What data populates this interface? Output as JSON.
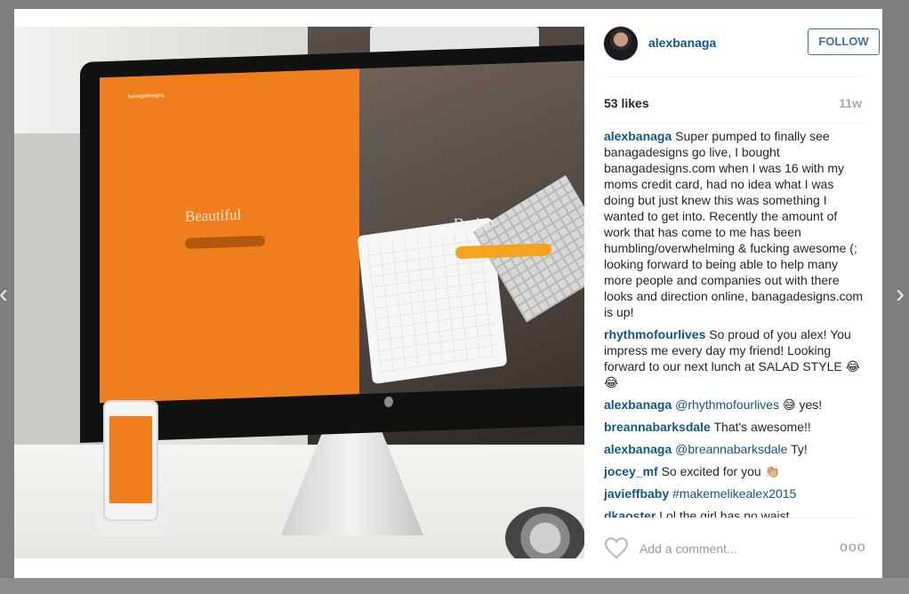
{
  "post": {
    "author": "alexbanaga",
    "follow_label": "FOLLOW",
    "likes": "53 likes",
    "time_ago": "11w"
  },
  "photo": {
    "screen_tag": "banagadesigns",
    "orange_word": "Beautiful",
    "right_word": "Design"
  },
  "comments": [
    {
      "user": "alexbanaga",
      "text": "Super pumped to finally see banagadesigns go live, I bought banagadesigns.com when I was 16 with my moms credit card, had no idea what I was doing but just knew this was something I wanted to get into. Recently the amount of work that has come to me has been humbling/overwhelming & fucking awesome (; looking forward to being able to help many more people and companies out with there looks and direction online, banagadesigns.com is up!"
    },
    {
      "user": "rhythmofourlives",
      "text": "So proud of you alex! You impress me every day my friend! Looking forward to our next lunch at SALAD STYLE 😂😂"
    },
    {
      "user": "alexbanaga",
      "mention": "@rhythmofourlives",
      "text": "😅 yes!"
    },
    {
      "user": "breannabarksdale",
      "text": "That's awesome!!"
    },
    {
      "user": "alexbanaga",
      "mention": "@breannabarksdale",
      "text": "Ty!"
    },
    {
      "user": "jocey_mf",
      "text": "So excited for you 👏🏼"
    },
    {
      "user": "javieffbaby",
      "mention": "#makemelikealex2015",
      "text": ""
    },
    {
      "user": "dkaoster",
      "text": "Lol the girl has no waist"
    }
  ],
  "footer": {
    "comment_placeholder": "Add a comment...",
    "more_label": "ooo"
  },
  "icons": {
    "prev": "chevron-left-icon",
    "next": "chevron-right-icon",
    "like": "heart-icon"
  },
  "colors": {
    "link": "#125688",
    "follow_border": "#3f729b",
    "time": "#a5a7aa",
    "orange": "#f07e1c"
  }
}
